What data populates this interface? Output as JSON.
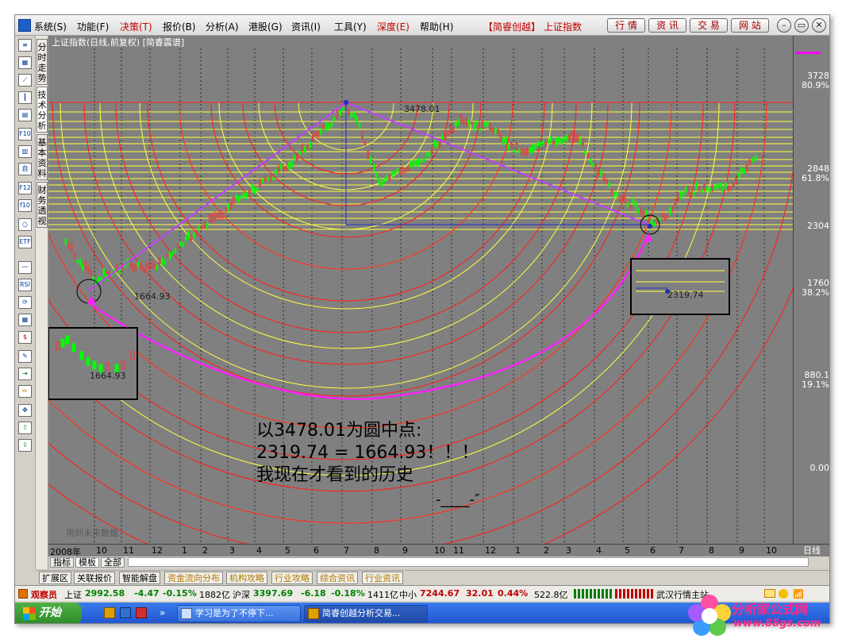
{
  "menu": {
    "items": [
      "系统(S)",
      "功能(F)",
      "决策(T)",
      "报价(B)",
      "分析(A)",
      "港股(G)",
      "资讯(I)",
      "工具(Y)",
      "深度(E)",
      "帮助(H)"
    ],
    "brand": "【简睿创越】",
    "index_name": "上证指数",
    "top_buttons": [
      "行 情",
      "资 讯",
      "交 易",
      "网 站"
    ]
  },
  "window_controls": [
    "–",
    "▭",
    "✕"
  ],
  "vertical_tabs": [
    "分时走势",
    "技术分析",
    "基本资料",
    "财务透视"
  ],
  "chart": {
    "title": "上证指数(日线,前复权) [简睿震谱]",
    "price_labels": [
      {
        "value": "3728",
        "pct": "80.9%"
      },
      {
        "value": "2848",
        "pct": "61.8%"
      },
      {
        "value": "2304",
        "pct": ""
      },
      {
        "value": "1760",
        "pct": "38.2%"
      },
      {
        "value": "880.1",
        "pct": "19.1%"
      },
      {
        "value": "0.00",
        "pct": ""
      }
    ],
    "annotations": {
      "peak": "3478.01",
      "low_left": "1664.93",
      "inset_right": "2319.74",
      "inset_left": "1664.93",
      "note_line1": "以3478.01为圆中点:",
      "note_line2": "2319.74 = 1664.93！！！",
      "note_line3": "我现在才看到的历史",
      "note_line4": "-____-″",
      "future_data": "用到未来数据"
    },
    "date_labels": [
      "2008年",
      "10",
      "11",
      "12",
      "1",
      "2",
      "3",
      "4",
      "5",
      "6",
      "7",
      "8",
      "9",
      "10",
      "11",
      "12",
      "1",
      "2",
      "3",
      "4",
      "5",
      "6",
      "7",
      "8",
      "9",
      "10"
    ],
    "period": "日线"
  },
  "sub_tabs": [
    "指标",
    "模板",
    "全部"
  ],
  "bottom_tabs": [
    {
      "label": "扩展区",
      "gold": false
    },
    {
      "label": "关联报价",
      "gold": false
    },
    {
      "label": "智能解盘",
      "gold": false
    },
    {
      "label": "资金流向分布",
      "gold": true
    },
    {
      "label": "机构攻略",
      "gold": true
    },
    {
      "label": "行业攻略",
      "gold": true
    },
    {
      "label": "综合资讯",
      "gold": true
    },
    {
      "label": "行业资讯",
      "gold": true
    }
  ],
  "status": {
    "observer": "观察员",
    "sh_label": "上证",
    "sh_value": "2992.58",
    "sh_change": "-4.47",
    "sh_pct": "-0.15%",
    "sh_amount": "1882亿",
    "hs_label": "沪深",
    "hs_value": "3397.69",
    "hs_change": "-6.18",
    "hs_pct": "-0.18%",
    "hs_amount": "1411亿",
    "zx_label": "中小",
    "zx_value": "7244.67",
    "zx_change": "32.01",
    "zx_pct": "0.44%",
    "zx_amount": "522.8亿",
    "server": "武汉行情主站"
  },
  "taskbar": {
    "start": "开始",
    "items": [
      "学习是为了不停下...",
      "简睿创越分析交易..."
    ]
  },
  "watermark": {
    "line1": "分析家公式网",
    "line2": "www.88gs.com"
  },
  "colors": {
    "chart_bg": "#808080",
    "circles": "#ff2020",
    "bands": "#ffff40",
    "trend": "#c040ff",
    "arrow": "#ff20ff",
    "up": "#ff3030",
    "down": "#00ff00"
  }
}
